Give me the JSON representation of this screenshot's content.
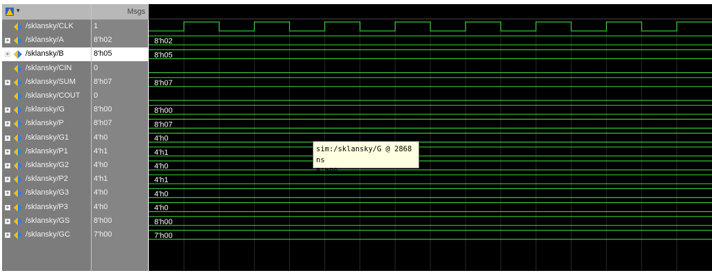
{
  "header": {
    "values_title": "Msgs"
  },
  "signals": [
    {
      "name": "/sklansky/CLK",
      "value": "1",
      "wave_label": "",
      "expandable": false,
      "selected": false
    },
    {
      "name": "/sklansky/A",
      "value": "8'h02",
      "wave_label": "8'h02",
      "expandable": true,
      "selected": false
    },
    {
      "name": "/sklansky/B",
      "value": "8'h05",
      "wave_label": "8'h05",
      "expandable": true,
      "selected": true
    },
    {
      "name": "/sklansky/CIN",
      "value": "0",
      "wave_label": "",
      "expandable": false,
      "selected": false
    },
    {
      "name": "/sklansky/SUM",
      "value": "8'h07",
      "wave_label": "8'h07",
      "expandable": true,
      "selected": false
    },
    {
      "name": "/sklansky/COUT",
      "value": "0",
      "wave_label": "",
      "expandable": false,
      "selected": false
    },
    {
      "name": "/sklansky/G",
      "value": "8'h00",
      "wave_label": "8'h00",
      "expandable": true,
      "selected": false
    },
    {
      "name": "/sklansky/P",
      "value": "8'h07",
      "wave_label": "8'h07",
      "expandable": true,
      "selected": false
    },
    {
      "name": "/sklansky/G1",
      "value": "4'h0",
      "wave_label": "4'h0",
      "expandable": true,
      "selected": false
    },
    {
      "name": "/sklansky/P1",
      "value": "4'h1",
      "wave_label": "4'h1",
      "expandable": true,
      "selected": false
    },
    {
      "name": "/sklansky/G2",
      "value": "4'h0",
      "wave_label": "4'h0",
      "expandable": true,
      "selected": false
    },
    {
      "name": "/sklansky/P2",
      "value": "4'h1",
      "wave_label": "4'h1",
      "expandable": true,
      "selected": false
    },
    {
      "name": "/sklansky/G3",
      "value": "4'h0",
      "wave_label": "4'h0",
      "expandable": true,
      "selected": false
    },
    {
      "name": "/sklansky/P3",
      "value": "4'h0",
      "wave_label": "4'h0",
      "expandable": true,
      "selected": false
    },
    {
      "name": "/sklansky/GS",
      "value": "8'h00",
      "wave_label": "8'h00",
      "expandable": true,
      "selected": false
    },
    {
      "name": "/sklansky/GC",
      "value": "7'h00",
      "wave_label": "7'h00",
      "expandable": true,
      "selected": false
    }
  ],
  "tooltip": {
    "line1": "sim:/sklansky/G @ 2868 ns",
    "line2": "8'h00"
  },
  "clock": {
    "half_periods": 16,
    "starts_low": true
  },
  "colors": {
    "wave": "#39c439",
    "divider": "#2a2a2a",
    "icon_blue": "#3a7bd5",
    "icon_yellow": "#f2c200"
  }
}
